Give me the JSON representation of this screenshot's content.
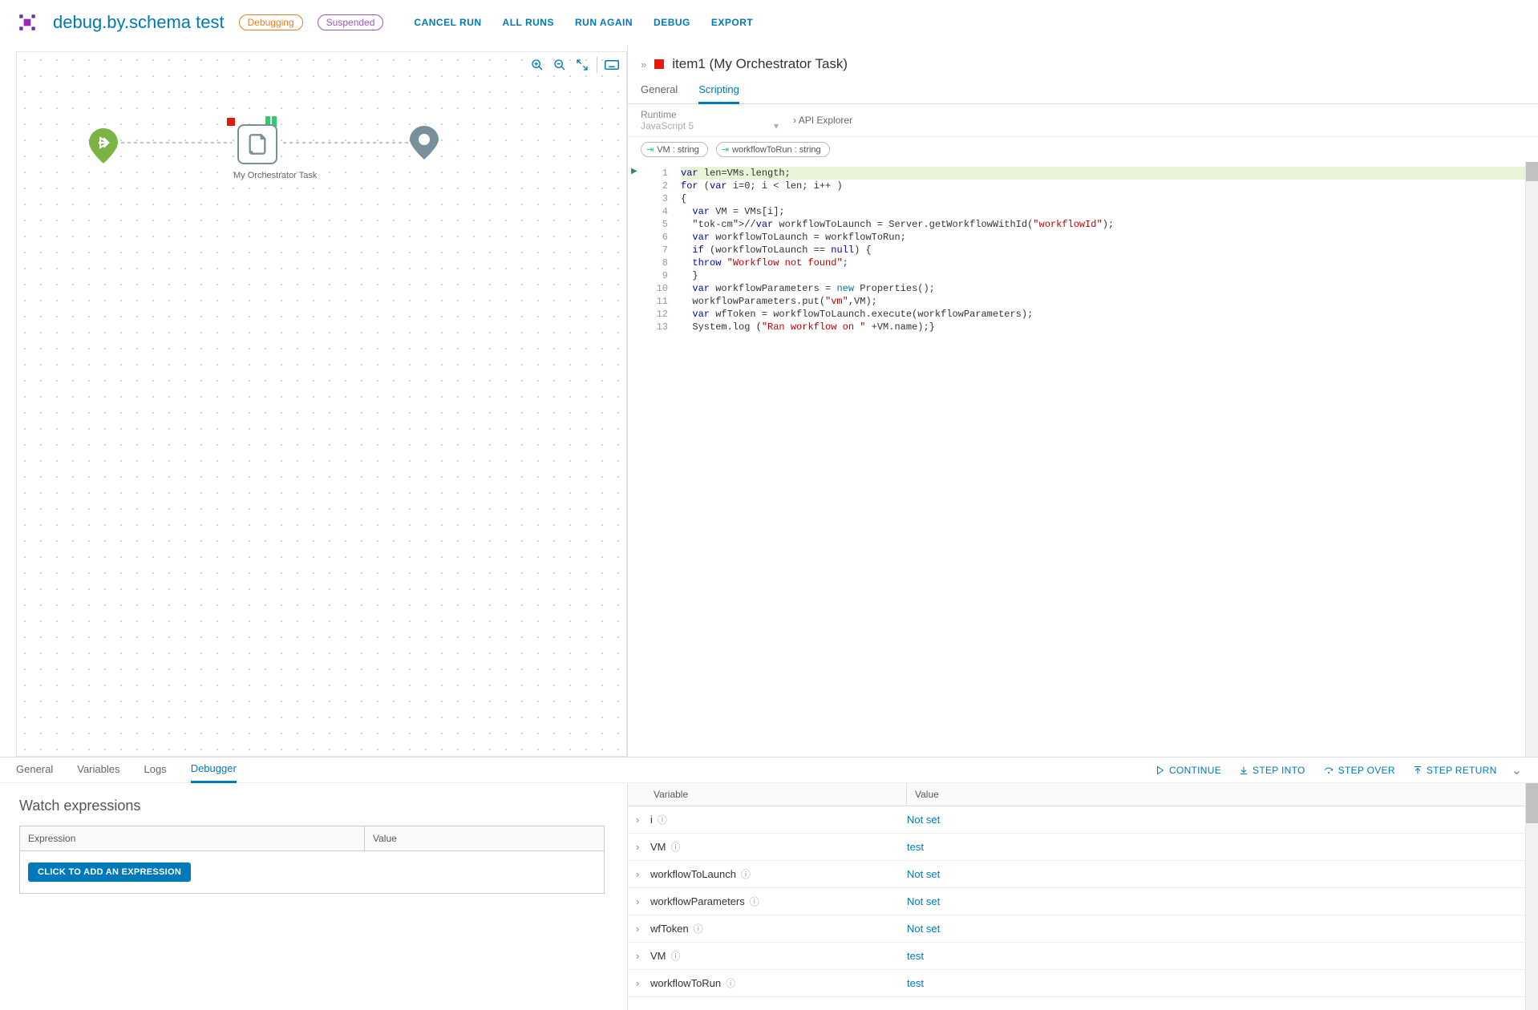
{
  "header": {
    "title": "debug.by.schema test",
    "badges": {
      "debug": "Debugging",
      "suspended": "Suspended"
    },
    "actions": [
      "CANCEL RUN",
      "ALL RUNS",
      "RUN AGAIN",
      "DEBUG",
      "EXPORT"
    ]
  },
  "canvas": {
    "task_label": "My Orchestrator Task",
    "toolbar": [
      "zoom-in-icon",
      "zoom-out-icon",
      "fit-icon",
      "keyboard-icon"
    ]
  },
  "details": {
    "title": "item1 (My Orchestrator Task)",
    "tabs": {
      "general": "General",
      "scripting": "Scripting"
    },
    "runtime_label": "Runtime",
    "runtime_value": "JavaScript 5",
    "api_explorer": "API Explorer",
    "inputs": [
      {
        "name": "VM : string"
      },
      {
        "name": "workflowToRun : string"
      }
    ],
    "code": [
      "var len=VMs.length;",
      "for (var i=0; i < len; i++ )",
      "{",
      "  var VM = VMs[i];",
      "  //var workflowToLaunch = Server.getWorkflowWithId(\"workflowId\");",
      "  var workflowToLaunch = workflowToRun;",
      "  if (workflowToLaunch == null) {",
      "  throw \"Workflow not found\";",
      "  }",
      "  var workflowParameters = new Properties();",
      "  workflowParameters.put(\"vm\",VM);",
      "  var wfToken = workflowToLaunch.execute(workflowParameters);",
      "  System.log (\"Ran workflow on \" +VM.name);}"
    ]
  },
  "bottom_tabs": {
    "general": "General",
    "variables": "Variables",
    "logs": "Logs",
    "debugger": "Debugger"
  },
  "debug_actions": {
    "continue": "CONTINUE",
    "step_into": "STEP INTO",
    "step_over": "STEP OVER",
    "step_return": "STEP RETURN"
  },
  "watch": {
    "title": "Watch expressions",
    "col_expr": "Expression",
    "col_val": "Value",
    "add_btn": "CLICK TO ADD AN EXPRESSION"
  },
  "vars": {
    "col_var": "Variable",
    "col_val": "Value",
    "rows": [
      {
        "name": "i",
        "value": "Not set"
      },
      {
        "name": "VM",
        "value": "test"
      },
      {
        "name": "workflowToLaunch",
        "value": "Not set"
      },
      {
        "name": "workflowParameters",
        "value": "Not set"
      },
      {
        "name": "wfToken",
        "value": "Not set"
      },
      {
        "name": "VM",
        "value": "test"
      },
      {
        "name": "workflowToRun",
        "value": "test"
      }
    ]
  }
}
